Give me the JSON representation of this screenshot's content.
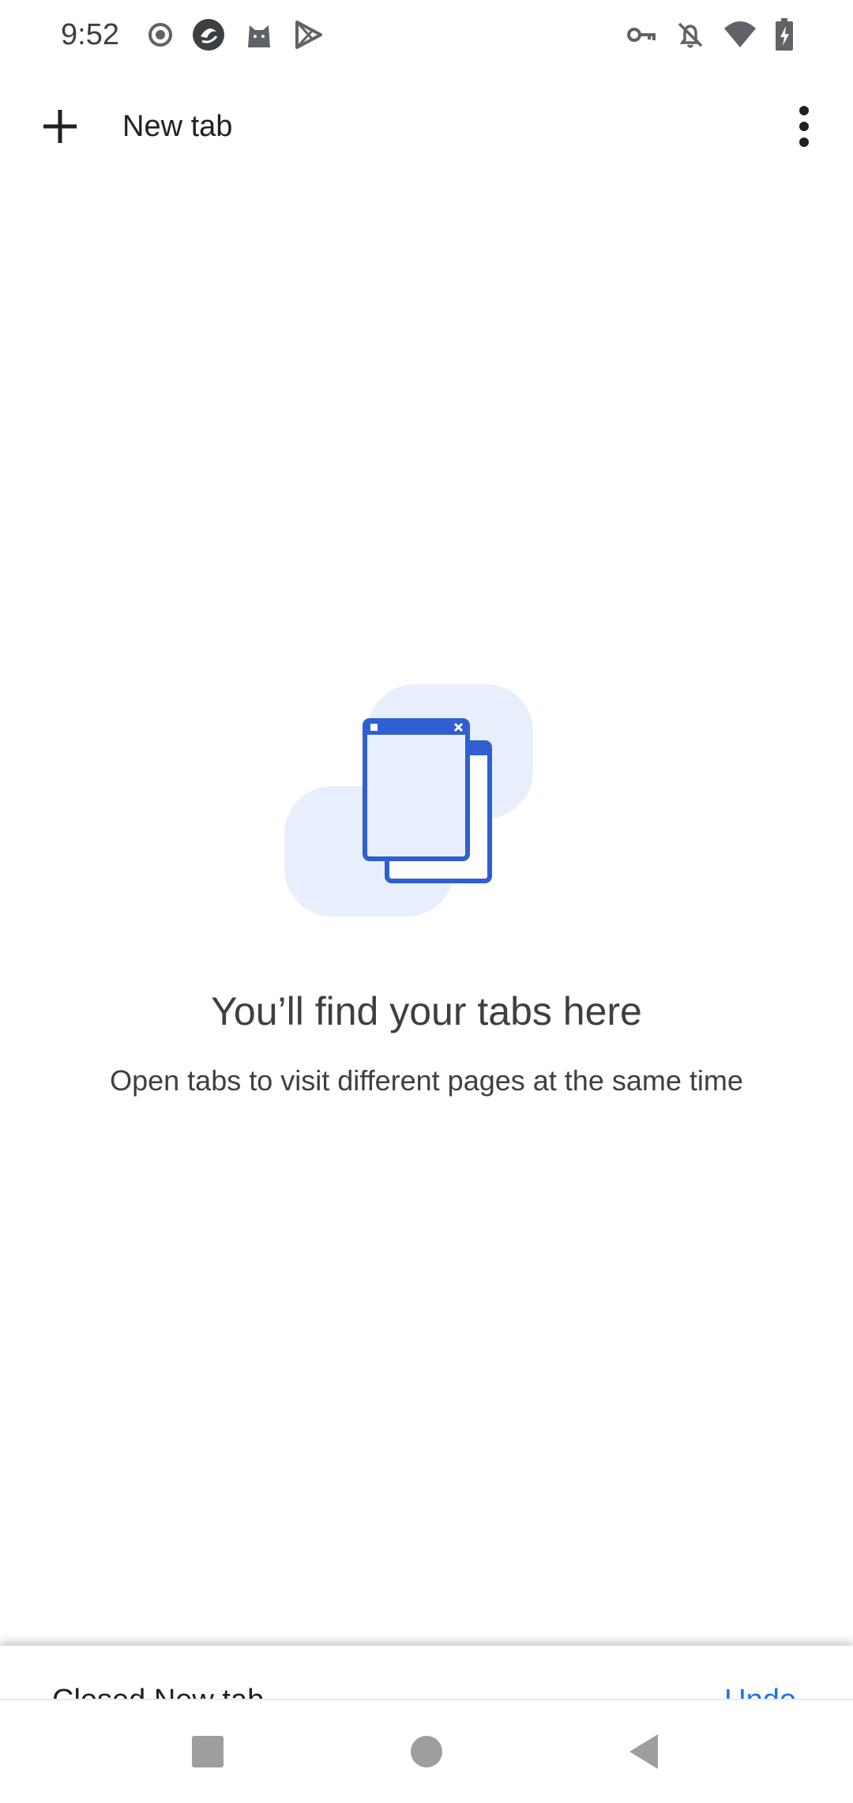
{
  "status_bar": {
    "time": "9:52",
    "left_icons": [
      "record-icon",
      "app-icon",
      "cat-icon",
      "play-store-icon"
    ],
    "right_icons": [
      "vpn-key-icon",
      "notifications-off-icon",
      "wifi-icon",
      "battery-charging-icon"
    ]
  },
  "toolbar": {
    "new_tab_label": "New tab",
    "new_tab_icon": "plus-icon",
    "menu_icon": "more-vert-icon"
  },
  "empty_state": {
    "title": "You’ll find your tabs here",
    "subtitle": "Open tabs to visit different pages at the same time",
    "illustration": "tabs-illustration"
  },
  "snackbar": {
    "message": "Closed New tab",
    "action": "Undo"
  },
  "nav_bar": {
    "buttons": [
      "recents-icon",
      "home-icon",
      "back-icon"
    ]
  },
  "colors": {
    "accent": "#1a73e8",
    "illustration_blue": "#2f5fd0",
    "illustration_fill": "#e8effc"
  }
}
